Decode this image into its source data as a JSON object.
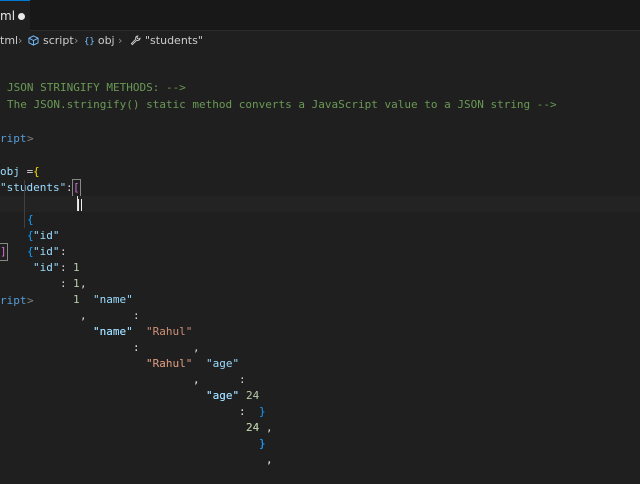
{
  "tab": {
    "label": "ml"
  },
  "breadcrumb": {
    "items": [
      "tml",
      "script",
      "obj",
      "\"students\""
    ],
    "icons": [
      "cube-icon",
      "variable-icon",
      "wrench-icon"
    ],
    "obj_prefix": "{}"
  },
  "code": {
    "l1_comment": "JSON STRINGIFY METHODS: -->",
    "l2_comment": "The JSON.stringify() static method converts a JavaScript value to a JSON string -->",
    "l4_tag": "ript",
    "l4_close": ">",
    "l6_var": "obj",
    "l6_eq": " =",
    "l6_brace": "{",
    "l7_key": "\"students\"",
    "l7_colon": ":",
    "l7_bracket": "[",
    "rows": [
      {
        "open": "{",
        "k1": "\"id\"",
        "v1": "1",
        "k2": "\"name\"",
        "v2": "\"Rahul\"",
        "k3": "\"age\"",
        "v3": "24",
        "close": "}",
        "tail": ","
      },
      {
        "open": "{",
        "k1": "\"id\"",
        "v1": "1",
        "k2": "\"name\"",
        "v2": "\"Rahul\"",
        "k3": "\"age\"",
        "v3": "24",
        "close": "}",
        "tail": ","
      },
      {
        "open": "{",
        "k1": "\"id\"",
        "v1": "1",
        "k2": "\"name\"",
        "v2": "\"Rahul\"",
        "k3": "\"age\"",
        "v3": "24",
        "close": "}",
        "tail": ","
      }
    ],
    "l11_bracket": "]",
    "l15_tag": "ript",
    "l15_close": ">"
  }
}
